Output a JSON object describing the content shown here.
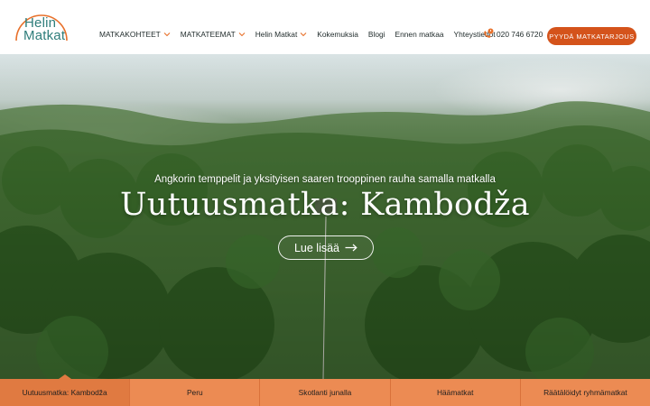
{
  "logo": {
    "line1": "Helin",
    "line2": "Matkat"
  },
  "nav": {
    "items": [
      {
        "label": "MATKAKOHTEET",
        "dropdown": true
      },
      {
        "label": "MATKATEEMAT",
        "dropdown": true
      },
      {
        "label": "Helin Matkat",
        "dropdown": true
      },
      {
        "label": "Kokemuksia",
        "dropdown": false
      },
      {
        "label": "Blogi",
        "dropdown": false
      },
      {
        "label": "Ennen matkaa",
        "dropdown": false
      },
      {
        "label": "Yhteystiedot",
        "dropdown": false
      }
    ]
  },
  "phone": {
    "number": "020 746 6720",
    "icon": "phone-icon"
  },
  "cta": {
    "label": "PYYDÄ MATKATARJOUS"
  },
  "hero": {
    "subtitle": "Angkorin temppelit ja yksityisen saaren trooppinen rauha samalla matkalla",
    "title": "Uutuusmatka: Kambodža",
    "button": "Lue lisää"
  },
  "tabs": [
    {
      "label": "Uutuusmatka: Kambodža",
      "active": true
    },
    {
      "label": "Peru",
      "active": false
    },
    {
      "label": "Skotlanti junalla",
      "active": false
    },
    {
      "label": "Häämatkat",
      "active": false
    },
    {
      "label": "Räätälöidyt ryhmämatkat",
      "active": false
    }
  ],
  "colors": {
    "accent": "#d4531b",
    "tab": "#ec8b53",
    "logo": "#2e7d7a"
  }
}
